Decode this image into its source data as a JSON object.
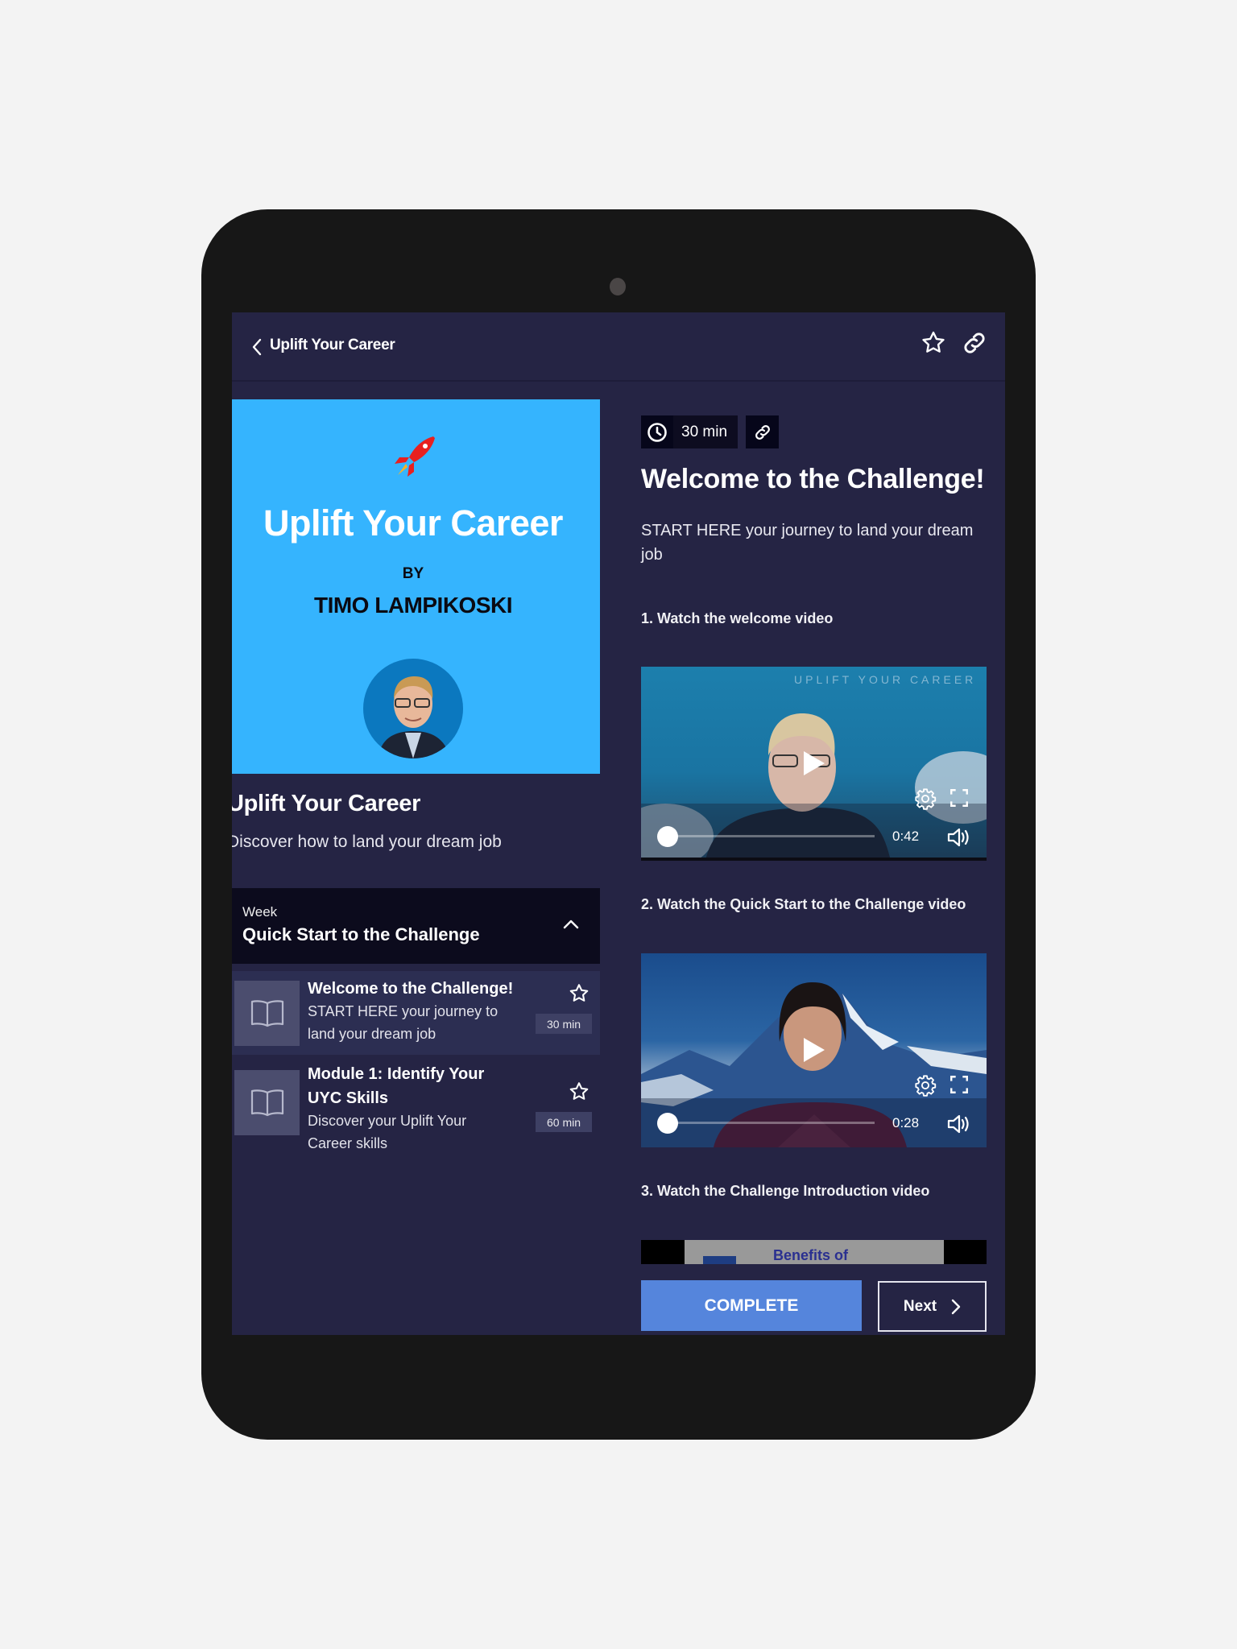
{
  "header": {
    "back_label": "Uplift Your Career",
    "icons": {
      "back": "chevron-left-icon",
      "favorite": "star-outline-icon",
      "share": "link-icon"
    }
  },
  "course": {
    "cover": {
      "title": "Uplift Your Career",
      "by": "BY",
      "author": "TIMO LAMPIKOSKI",
      "background": "#35b4fe"
    },
    "title": "Uplift Your Career",
    "subtitle": "Discover how to land your dream job"
  },
  "week": {
    "label": "Week",
    "title": "Quick Start to the Challenge",
    "expanded": true,
    "lessons": [
      {
        "title": "Welcome to the Challenge!",
        "description": "START HERE your journey to land your dream job",
        "duration": "30 min",
        "active": true
      },
      {
        "title": "Module 1: Identify Your UYC Skills",
        "description": "Discover your Uplift Your Career skills",
        "duration": "60 min",
        "active": false
      }
    ]
  },
  "lesson": {
    "duration": "30 min",
    "title": "Welcome to the Challenge!",
    "intro": "START HERE your journey to land your dream job",
    "steps": [
      {
        "label": "1. Watch the welcome video",
        "video": {
          "watermark": "UPLIFT YOUR CAREER",
          "time": "0:42"
        }
      },
      {
        "label": "2. Watch the Quick Start to the Challenge video",
        "video": {
          "time": "0:28"
        }
      },
      {
        "label": "3. Watch the Challenge Introduction video",
        "video": {
          "slide_text": "Benefits of"
        }
      }
    ]
  },
  "actions": {
    "complete_label": "COMPLETE",
    "next_label": "Next",
    "accent": "#5585dc"
  }
}
